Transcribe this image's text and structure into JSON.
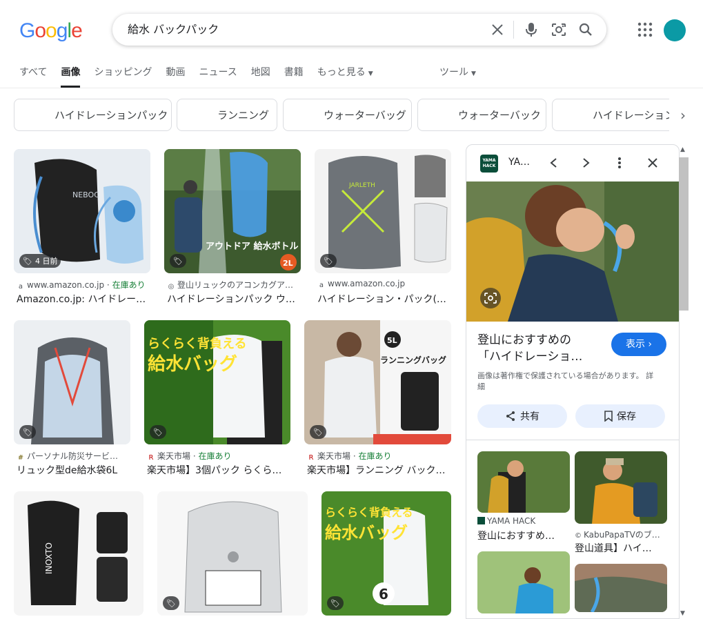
{
  "logo": {
    "letters": [
      "G",
      "o",
      "o",
      "g",
      "l",
      "e"
    ],
    "colors": [
      "#4285f4",
      "#ea4335",
      "#fbbc05",
      "#4285f4",
      "#34a853",
      "#ea4335"
    ]
  },
  "search": {
    "query": "給水 バックパック"
  },
  "tabs": [
    {
      "label": "すべて",
      "active": false
    },
    {
      "label": "画像",
      "active": true
    },
    {
      "label": "ショッピング",
      "active": false
    },
    {
      "label": "動画",
      "active": false
    },
    {
      "label": "ニュース",
      "active": false
    },
    {
      "label": "地図",
      "active": false
    },
    {
      "label": "書籍",
      "active": false
    },
    {
      "label": "もっと見る",
      "active": false
    }
  ],
  "tools_label": "ツール",
  "chips": [
    {
      "label": "ハイドレーションパック",
      "color": "#3f6fb5"
    },
    {
      "label": "ランニング",
      "color": "#9aa4ad"
    },
    {
      "label": "ウォーターバッグ",
      "color": "#c9c2b6"
    },
    {
      "label": "ウォーターバック",
      "color": "#333333"
    },
    {
      "label": "ハイドレーション",
      "color": "#b99a66"
    }
  ],
  "results": [
    {
      "badge": "4 日前",
      "source": "www.amazon.co.jp",
      "stock": "在庫あり",
      "title": "Amazon.co.jp: ハイドレー…",
      "fav": "a"
    },
    {
      "badge": "",
      "source": "登山リュックのアコンカグア…",
      "stock": "",
      "title": "ハイドレーションパック ウ…",
      "fav": "◎",
      "overlay": "アウトドア 給水ボトル",
      "badge2": "2L"
    },
    {
      "badge": "",
      "source": "www.amazon.co.jp",
      "stock": "",
      "title": "ハイドレーション・パック(…",
      "fav": "a"
    },
    {
      "badge": "",
      "source": "パーソナル防災サービ…",
      "stock": "",
      "title": "リュック型de給水袋6L",
      "fav": "#"
    },
    {
      "badge": "",
      "source": "楽天市場",
      "stock": "在庫あり",
      "title": "楽天市場】3個パック らくら…",
      "fav": "R",
      "overlay1": "らくらく背負える",
      "overlay2": "給水バッグ"
    },
    {
      "badge": "",
      "source": "楽天市場",
      "stock": "在庫あり",
      "title": "楽天市場】ランニング バック…",
      "fav": "R",
      "overlay": "ランニングバッグ",
      "overlay2": "5L"
    },
    {
      "badge": "",
      "source": "",
      "stock": "",
      "title": "",
      "overlay": "INOXTO"
    },
    {
      "badge": "",
      "source": "",
      "stock": "",
      "title": ""
    },
    {
      "badge": "",
      "source": "",
      "stock": "",
      "title": "",
      "overlay1": "らくらく背負える",
      "overlay2": "給水バッグ",
      "num": "6"
    }
  ],
  "panel": {
    "site": "YA…",
    "logo_text": "YAMA HACK",
    "title_line1": "登山におすすめの",
    "title_line2": "「ハイドレーショ…",
    "visit": "表示",
    "copyright": "画像は著作権で保護されている場合があります。",
    "details": "詳細",
    "share": "共有",
    "save": "保存",
    "related": [
      {
        "source": "YAMA HACK",
        "title": "登山におすすめ…"
      },
      {
        "source": "KabuPapaTVのブ…",
        "title": "登山道具】ハイ…"
      },
      {
        "source": "",
        "title": ""
      },
      {
        "source": "",
        "title": ""
      }
    ]
  }
}
